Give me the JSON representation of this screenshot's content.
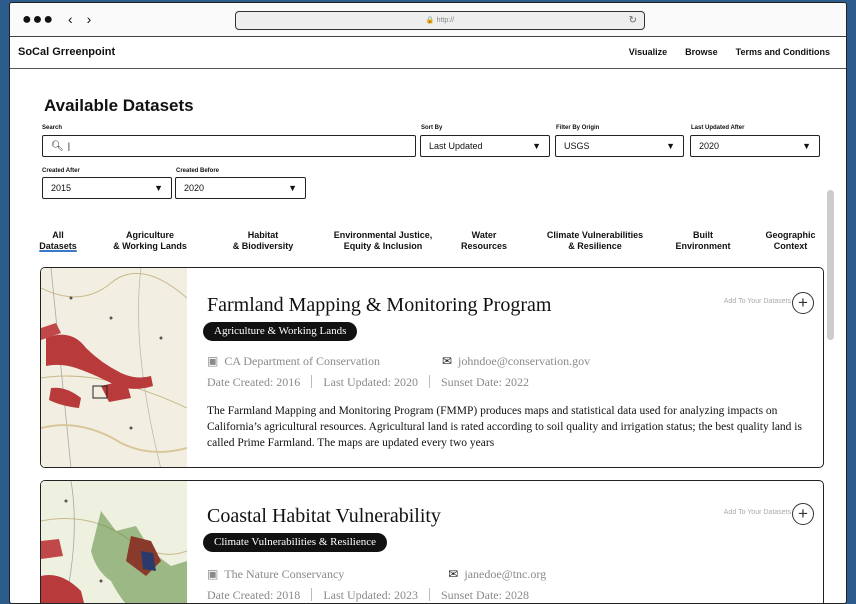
{
  "browser": {
    "dots": "●●●",
    "back": "‹",
    "forward": "›",
    "url": "🔒 http://",
    "reload": "↻"
  },
  "header": {
    "brand": "SoCal Grreenpoint",
    "nav": [
      "Visualize",
      "Browse",
      "Terms and Conditions"
    ]
  },
  "page": {
    "title": "Available Datasets"
  },
  "filters": {
    "search_label": "Search",
    "search_value": "|",
    "sort_label": "Sort By",
    "sort_value": "Last Updated",
    "origin_label": "Filter By Origin",
    "origin_value": "USGS",
    "updated_label": "Last Updated After",
    "updated_value": "2020",
    "created_after_label": "Created After",
    "created_after_value": "2015",
    "created_before_label": "Created Before",
    "created_before_value": "2020"
  },
  "tabs": [
    {
      "l1": "All",
      "l2": "Datasets"
    },
    {
      "l1": "Agriculture",
      "l2": "& Working Lands"
    },
    {
      "l1": "Habitat",
      "l2": "& Biodiversity"
    },
    {
      "l1": "Environmental Justice,",
      "l2": "Equity & Inclusion"
    },
    {
      "l1": "Water",
      "l2": "Resources"
    },
    {
      "l1": "Climate Vulnerabilities",
      "l2": "& Resilience"
    },
    {
      "l1": "Built",
      "l2": "Environment"
    },
    {
      "l1": "Geographic",
      "l2": "Context"
    }
  ],
  "datasets": [
    {
      "title": "Farmland Mapping & Monitoring Program",
      "category": "Agriculture & Working Lands",
      "org": "CA Department of Conservation",
      "email": "johndoe@conservation.gov",
      "created": "Date Created: 2016",
      "updated": "Last Updated: 2020",
      "sunset": "Sunset Date: 2022",
      "description": "The Farmland Mapping and Monitoring Program (FMMP) produces maps and statistical data used for analyzing impacts on California’s agricultural resources. Agricultural land is rated according to soil quality and irrigation status; the best quality land is called Prime Farmland. The maps are updated every two years",
      "add_label": "Add To Your Datasets"
    },
    {
      "title": "Coastal Habitat Vulnerability",
      "category": "Climate Vulnerabilities & Resilience",
      "org": "The Nature Conservancy",
      "email": "janedoe@tnc.org",
      "created": "Date Created: 2018",
      "updated": "Last Updated: 2023",
      "sunset": "Sunset Date: 2028",
      "add_label": "Add To Your Datasets"
    }
  ],
  "icons": {
    "search": "search-icon",
    "org": "building-icon",
    "email": "envelope-icon",
    "add": "plus-circle-icon",
    "caret": "▼",
    "plus": "+"
  },
  "colors": {
    "background": "#2b5c8c",
    "badge": "#111111",
    "active_tab_underline": "#3a78c8",
    "map_red": "#b83a3a"
  }
}
